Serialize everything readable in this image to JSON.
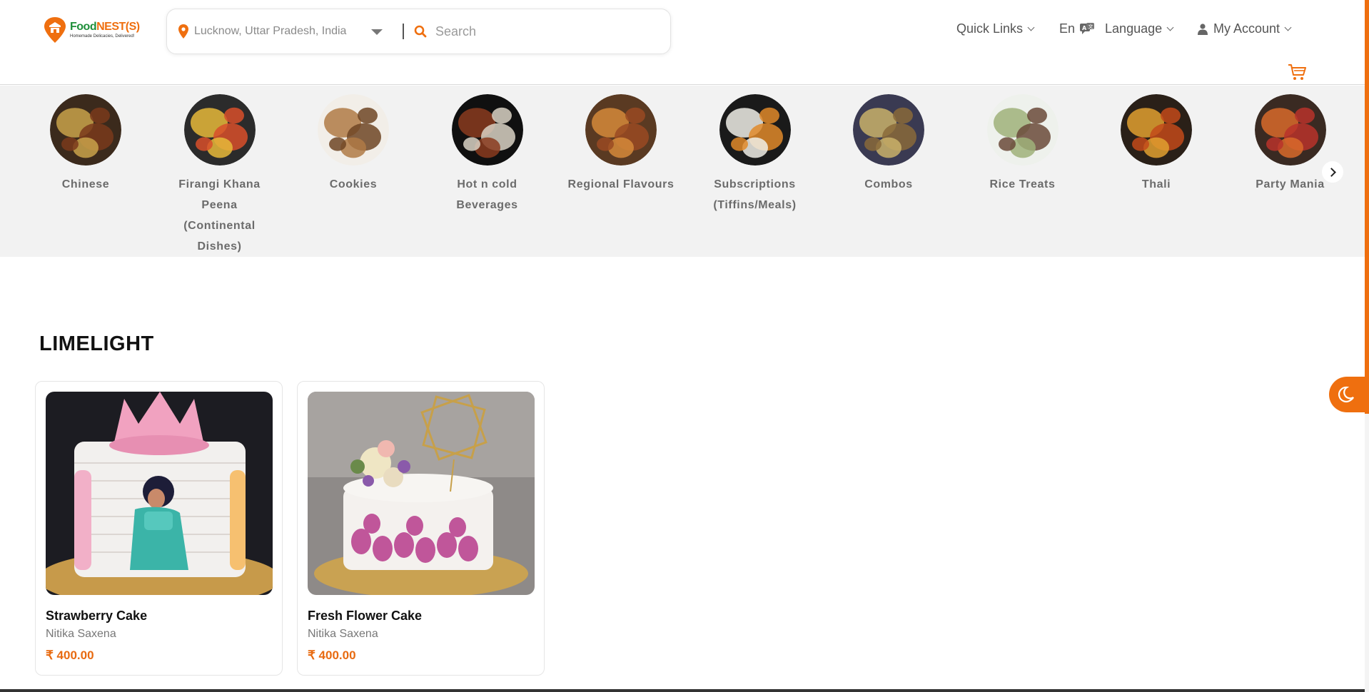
{
  "brand": {
    "name_part1": "Food",
    "name_part2": "NEST(S)",
    "tagline": "Homemade Delicacies, Delivered!"
  },
  "search": {
    "location": "Lucknow, Uttar Pradesh, India",
    "placeholder": "Search"
  },
  "nav": {
    "quick_links": "Quick Links",
    "lang_code": "En",
    "language": "Language",
    "my_account": "My Account"
  },
  "categories": [
    {
      "label": "Chinese",
      "colors": [
        "#3b2a1c",
        "#c9a24a",
        "#7a3a1b"
      ]
    },
    {
      "label": "Firangi Khana Peena (Continental Dishes)",
      "colors": [
        "#2b2b2b",
        "#e6b93a",
        "#d84f2a"
      ]
    },
    {
      "label": "Cookies",
      "colors": [
        "#f2eee8",
        "#b07a45",
        "#6e4524"
      ]
    },
    {
      "label": "Hot n cold Beverages",
      "colors": [
        "#101010",
        "#8a3b1e",
        "#d9d2c4"
      ]
    },
    {
      "label": "Regional Flavours",
      "colors": [
        "#5a3a22",
        "#d58a3a",
        "#9a4a22"
      ]
    },
    {
      "label": "Subscriptions (Tiffins/Meals)",
      "colors": [
        "#1a1a1a",
        "#f0efe8",
        "#e08a2a"
      ]
    },
    {
      "label": "Combos",
      "colors": [
        "#3a3a52",
        "#c9b26a",
        "#8a6a3a"
      ]
    },
    {
      "label": "Rice Treats",
      "colors": [
        "#eef1ec",
        "#9fb27a",
        "#6a4a3a"
      ]
    },
    {
      "label": "Thali",
      "colors": [
        "#2a2018",
        "#e0a030",
        "#c24a1a"
      ]
    },
    {
      "label": "Party Mania",
      "colors": [
        "#3a2a22",
        "#d86a2a",
        "#b8322a"
      ]
    }
  ],
  "section": {
    "title": "LIMELIGHT"
  },
  "products": [
    {
      "name": "Strawberry Cake",
      "seller": "Nitika Saxena",
      "price": "₹ 400.00"
    },
    {
      "name": "Fresh Flower Cake",
      "seller": "Nitika Saxena",
      "price": "₹ 400.00"
    }
  ],
  "colors": {
    "accent": "#ef6f0f",
    "brand_green": "#1f8f3a",
    "strip_bg": "#f2f2f2"
  }
}
